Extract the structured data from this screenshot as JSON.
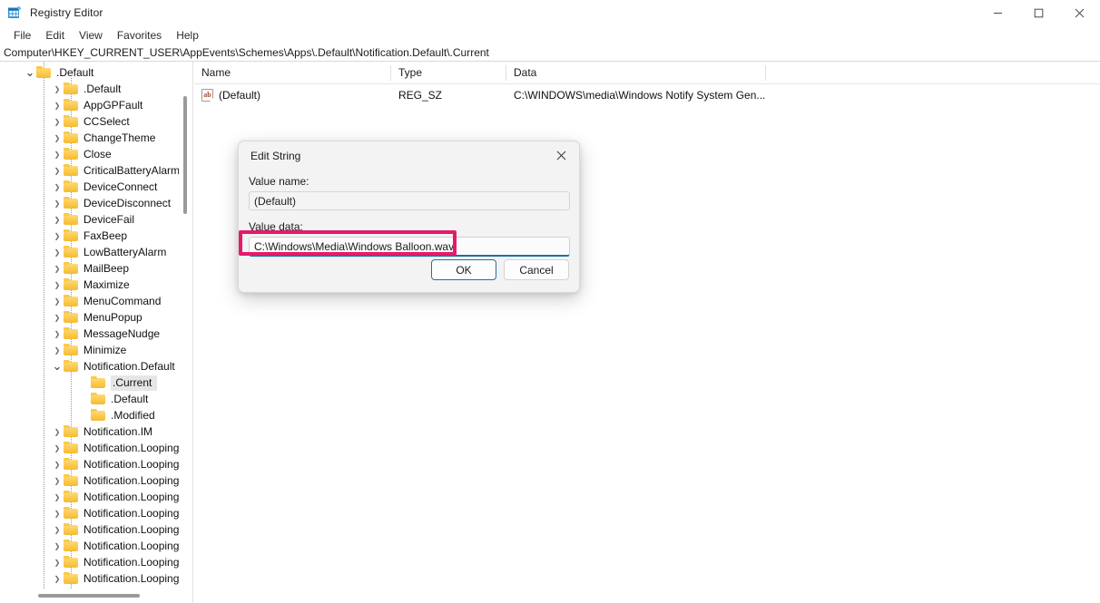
{
  "window": {
    "title": "Registry Editor",
    "icon": "registry-editor-icon",
    "minimize_label": "Minimize",
    "maximize_label": "Maximize",
    "close_label": "Close"
  },
  "menubar": {
    "items": [
      {
        "label": "File"
      },
      {
        "label": "Edit"
      },
      {
        "label": "View"
      },
      {
        "label": "Favorites"
      },
      {
        "label": "Help"
      }
    ]
  },
  "address": {
    "path": "Computer\\HKEY_CURRENT_USER\\AppEvents\\Schemes\\Apps\\.Default\\Notification.Default\\.Current"
  },
  "tree": {
    "items": [
      {
        "label": ".Default",
        "indent": 0,
        "state": "open",
        "selected": false
      },
      {
        "label": ".Default",
        "indent": 1,
        "state": "collapsed",
        "selected": false
      },
      {
        "label": "AppGPFault",
        "indent": 1,
        "state": "collapsed",
        "selected": false
      },
      {
        "label": "CCSelect",
        "indent": 1,
        "state": "collapsed",
        "selected": false
      },
      {
        "label": "ChangeTheme",
        "indent": 1,
        "state": "collapsed",
        "selected": false
      },
      {
        "label": "Close",
        "indent": 1,
        "state": "collapsed",
        "selected": false
      },
      {
        "label": "CriticalBatteryAlarm",
        "indent": 1,
        "state": "collapsed",
        "selected": false
      },
      {
        "label": "DeviceConnect",
        "indent": 1,
        "state": "collapsed",
        "selected": false
      },
      {
        "label": "DeviceDisconnect",
        "indent": 1,
        "state": "collapsed",
        "selected": false
      },
      {
        "label": "DeviceFail",
        "indent": 1,
        "state": "collapsed",
        "selected": false
      },
      {
        "label": "FaxBeep",
        "indent": 1,
        "state": "collapsed",
        "selected": false
      },
      {
        "label": "LowBatteryAlarm",
        "indent": 1,
        "state": "collapsed",
        "selected": false
      },
      {
        "label": "MailBeep",
        "indent": 1,
        "state": "collapsed",
        "selected": false
      },
      {
        "label": "Maximize",
        "indent": 1,
        "state": "collapsed",
        "selected": false
      },
      {
        "label": "MenuCommand",
        "indent": 1,
        "state": "collapsed",
        "selected": false
      },
      {
        "label": "MenuPopup",
        "indent": 1,
        "state": "collapsed",
        "selected": false
      },
      {
        "label": "MessageNudge",
        "indent": 1,
        "state": "collapsed",
        "selected": false
      },
      {
        "label": "Minimize",
        "indent": 1,
        "state": "collapsed",
        "selected": false
      },
      {
        "label": "Notification.Default",
        "indent": 1,
        "state": "open",
        "selected": false
      },
      {
        "label": ".Current",
        "indent": 2,
        "state": "leaf",
        "selected": true
      },
      {
        "label": ".Default",
        "indent": 2,
        "state": "leaf",
        "selected": false
      },
      {
        "label": ".Modified",
        "indent": 2,
        "state": "leaf",
        "selected": false
      },
      {
        "label": "Notification.IM",
        "indent": 1,
        "state": "collapsed",
        "selected": false
      },
      {
        "label": "Notification.Looping",
        "indent": 1,
        "state": "collapsed",
        "selected": false
      },
      {
        "label": "Notification.Looping",
        "indent": 1,
        "state": "collapsed",
        "selected": false
      },
      {
        "label": "Notification.Looping",
        "indent": 1,
        "state": "collapsed",
        "selected": false
      },
      {
        "label": "Notification.Looping",
        "indent": 1,
        "state": "collapsed",
        "selected": false
      },
      {
        "label": "Notification.Looping",
        "indent": 1,
        "state": "collapsed",
        "selected": false
      },
      {
        "label": "Notification.Looping",
        "indent": 1,
        "state": "collapsed",
        "selected": false
      },
      {
        "label": "Notification.Looping",
        "indent": 1,
        "state": "collapsed",
        "selected": false
      },
      {
        "label": "Notification.Looping",
        "indent": 1,
        "state": "collapsed",
        "selected": false
      },
      {
        "label": "Notification.Looping",
        "indent": 1,
        "state": "collapsed",
        "selected": false
      }
    ]
  },
  "list": {
    "columns": [
      {
        "label": "Name"
      },
      {
        "label": "Type"
      },
      {
        "label": "Data"
      }
    ],
    "rows": [
      {
        "icon": "string-value-icon",
        "icon_text": "ab",
        "name": "(Default)",
        "type": "REG_SZ",
        "data": "C:\\WINDOWS\\media\\Windows Notify System Gen..."
      }
    ]
  },
  "dialog": {
    "title": "Edit String",
    "close_label": "Close",
    "value_name_label": "Value name:",
    "value_name": "(Default)",
    "value_data_label": "Value data:",
    "value_data": "C:\\Windows\\Media\\Windows Balloon.wav",
    "ok_label": "OK",
    "cancel_label": "Cancel"
  },
  "annotation": {
    "color": "#e51a6a",
    "target": "value-data-input"
  }
}
